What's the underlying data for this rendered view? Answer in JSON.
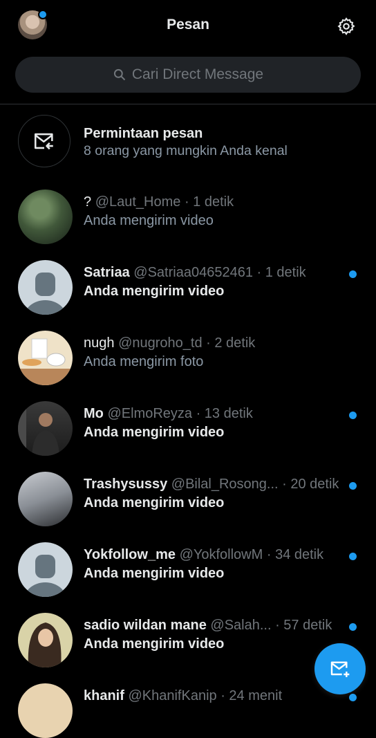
{
  "header": {
    "title": "Pesan",
    "avatar_icon": "profile-avatar",
    "settings_icon": "gear-icon"
  },
  "search": {
    "placeholder": "Cari Direct Message",
    "icon": "search-icon"
  },
  "message_request": {
    "icon": "envelope-arrow-icon",
    "title": "Permintaan pesan",
    "subtitle": "8 orang yang mungkin Anda kenal"
  },
  "conversations": [
    {
      "name": "?",
      "handle": "@Laut_Home",
      "time": "· 1 detik",
      "preview": "Anda mengirim video",
      "unread": false
    },
    {
      "name": "Satriaa",
      "handle": "@Satriaa04652461",
      "time": "· 1 detik",
      "preview": "Anda mengirim video",
      "unread": true
    },
    {
      "name": "nugh",
      "handle": "@nugroho_td",
      "time": "· 2 detik",
      "preview": "Anda mengirim foto",
      "unread": false
    },
    {
      "name": "Mo",
      "handle": "@ElmoReyza",
      "time": "· 13 detik",
      "preview": "Anda mengirim video",
      "unread": true
    },
    {
      "name": "Trashysussy",
      "handle": "@Bilal_Rosong...",
      "time": "· 20 detik",
      "preview": "Anda mengirim video",
      "unread": true
    },
    {
      "name": "Yokfollow_me",
      "handle": "@YokfollowM",
      "time": "· 34 detik",
      "preview": "Anda mengirim video",
      "unread": true
    },
    {
      "name": "sadio wildan mane",
      "handle": "@Salah...",
      "time": "· 57 detik",
      "preview": "Anda mengirim video",
      "unread": true
    },
    {
      "name": "khanif",
      "handle": "@KhanifKanip",
      "time": "· 24 menit",
      "preview": "",
      "unread": true
    }
  ],
  "fab": {
    "icon": "new-message-icon"
  },
  "colors": {
    "accent": "#1d9bf0",
    "background": "#000000",
    "muted": "#71767b"
  }
}
